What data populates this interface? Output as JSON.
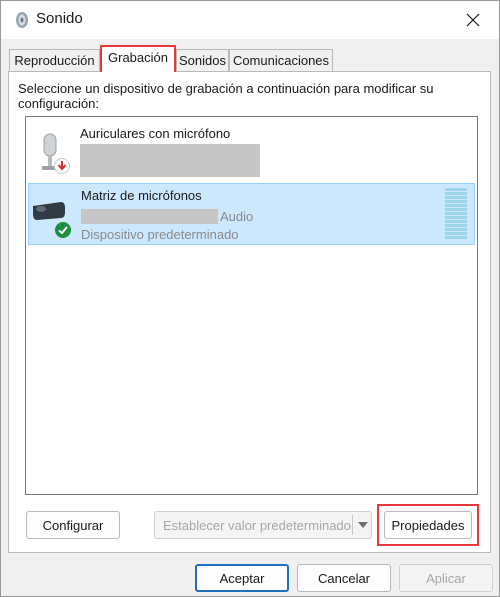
{
  "window": {
    "title": "Sonido",
    "icon": "speaker-icon"
  },
  "tabs": [
    {
      "label": "Reproducción"
    },
    {
      "label": "Grabación",
      "active": true
    },
    {
      "label": "Sonidos"
    },
    {
      "label": "Comunicaciones"
    }
  ],
  "instructions": "Seleccione un dispositivo de grabación a continuación para modificar su configuración:",
  "devices": [
    {
      "name": "Auriculares con micrófono",
      "icon": "headset-microphone-icon",
      "status_icon": "down-arrow-red-icon"
    },
    {
      "name": "Matriz de micrófonos",
      "suffix": "Audio",
      "status": "Dispositivo predeterminado",
      "icon": "microphone-array-icon",
      "status_icon": "check-green-icon",
      "selected": true
    }
  ],
  "buttons": {
    "configure": "Configurar",
    "set_default": "Establecer valor predeterminado",
    "properties": "Propiedades",
    "ok": "Aceptar",
    "cancel": "Cancelar",
    "apply": "Aplicar"
  },
  "colors": {
    "highlight": "#e4393c",
    "selection": "#cce8ff",
    "primary_border": "#1f6fbd"
  }
}
